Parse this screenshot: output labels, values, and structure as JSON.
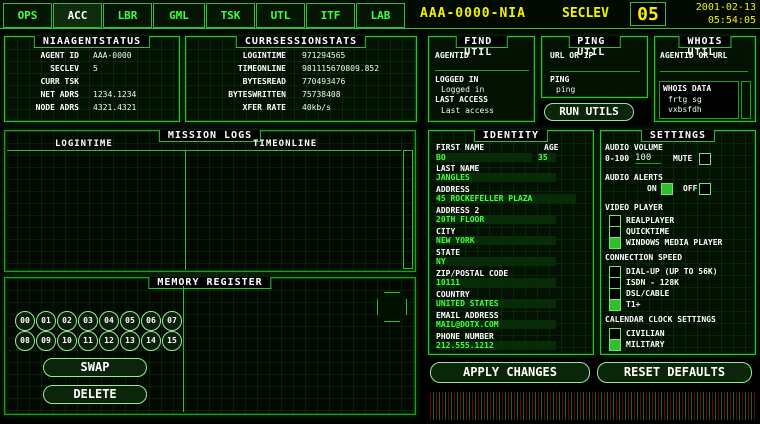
{
  "tabs": [
    {
      "label": "OPS"
    },
    {
      "label": "ACC"
    },
    {
      "label": "LBR"
    },
    {
      "label": "GML"
    },
    {
      "label": "TSK"
    },
    {
      "label": "UTL"
    },
    {
      "label": "ITF"
    },
    {
      "label": "LAB"
    }
  ],
  "header": {
    "agent_code": "AAA-0000-NIA",
    "seclev_label": "SECLEV",
    "seclev_value": "05",
    "date": "2001-02-13",
    "time": "05:54:05"
  },
  "agent_status": {
    "title": "NIAAGENTSTATUS",
    "rows": [
      {
        "label": "AGENT ID",
        "value": "AAA-0000"
      },
      {
        "label": "SECLEV",
        "value": "5"
      },
      {
        "label": "CURR TSK",
        "value": ""
      },
      {
        "label": "NET ADRS",
        "value": "1234.1234"
      },
      {
        "label": "NODE ADRS",
        "value": "4321.4321"
      }
    ]
  },
  "session_stats": {
    "title": "CURRSESSIONSTATS",
    "rows": [
      {
        "label": "LOGINTIME",
        "value": "971294565"
      },
      {
        "label": "TIMEONLINE",
        "value": "981115670809.852"
      },
      {
        "label": "BYTESREAD",
        "value": "770493476"
      },
      {
        "label": "BYTESWRITTEN",
        "value": "75738408"
      },
      {
        "label": "XFER RATE",
        "value": "40kb/s"
      }
    ]
  },
  "find_util": {
    "title": "FIND UTIL",
    "agentid_label": "AGENTID",
    "logged_in_label": "LOGGED IN",
    "logged_in_value": "Logged in",
    "last_access_label": "LAST ACCESS",
    "last_access_value": "Last access"
  },
  "ping_util": {
    "title": "PING UTIL",
    "url_label": "URL OR IP",
    "ping_label": "PING",
    "ping_value": "ping"
  },
  "whois_util": {
    "title": "WHOIS UTIL",
    "agent_label": "AGENTID OR URL",
    "data_label": "WHOIS DATA",
    "data_value": "frtg sg vxbsfdh"
  },
  "run_utils_label": "RUN UTILS",
  "mission_logs": {
    "title": "MISSION LOGS",
    "col1": "LOGINTIME",
    "col2": "TIMEONLINE"
  },
  "memory_register": {
    "title": "MEMORY REGISTER",
    "buttons": [
      "00",
      "01",
      "02",
      "03",
      "04",
      "05",
      "06",
      "07",
      "08",
      "09",
      "10",
      "11",
      "12",
      "13",
      "14",
      "15"
    ],
    "swap_label": "SWAP",
    "delete_label": "DELETE"
  },
  "identity": {
    "title": "IDENTITY",
    "first_name_label": "FIRST NAME",
    "first_name": "BO",
    "age_label": "AGE",
    "age": "35",
    "last_name_label": "LAST NAME",
    "last_name": "JANGLES",
    "address_label": "ADDRESS",
    "address": "45 ROCKEFELLER PLAZA",
    "address2_label": "ADDRESS 2",
    "address2": "20TH FLOOR",
    "city_label": "CITY",
    "city": "NEW YORK",
    "state_label": "STATE",
    "state": "NY",
    "zip_label": "ZIP/POSTAL CODE",
    "zip": "10111",
    "country_label": "COUNTRY",
    "country": "UNITED STATES",
    "email_label": "EMAIL ADDRESS",
    "email": "MAIL@DOTX.COM",
    "phone_label": "PHONE NUMBER",
    "phone": "212.555.1212"
  },
  "settings": {
    "title": "SETTINGS",
    "audio_volume_label": "AUDIO VOLUME",
    "volume_range": "0-100",
    "volume_value": "100",
    "mute_label": "MUTE",
    "audio_alerts_label": "AUDIO ALERTS",
    "on_label": "ON",
    "off_label": "OFF",
    "video_player_label": "VIDEO PLAYER",
    "video_options": [
      "REALPLAYER",
      "QUICKTIME",
      "WINDOWS MEDIA PLAYER"
    ],
    "connection_label": "CONNECTION SPEED",
    "connection_options": [
      "DIAL-UP (UP TO 56K)",
      "ISDN - 128K",
      "DSL/CABLE",
      "T1+"
    ],
    "calendar_label": "CALENDAR CLOCK SETTINGS",
    "calendar_options": [
      "CIVILIAN",
      "MILITARY"
    ]
  },
  "apply_label": "APPLY CHANGES",
  "reset_label": "RESET DEFAULTS",
  "colors": {
    "accent": "#2fbf2f",
    "highlight": "#44ff44",
    "yellow": "#f2f200",
    "text": "#ffffff"
  }
}
